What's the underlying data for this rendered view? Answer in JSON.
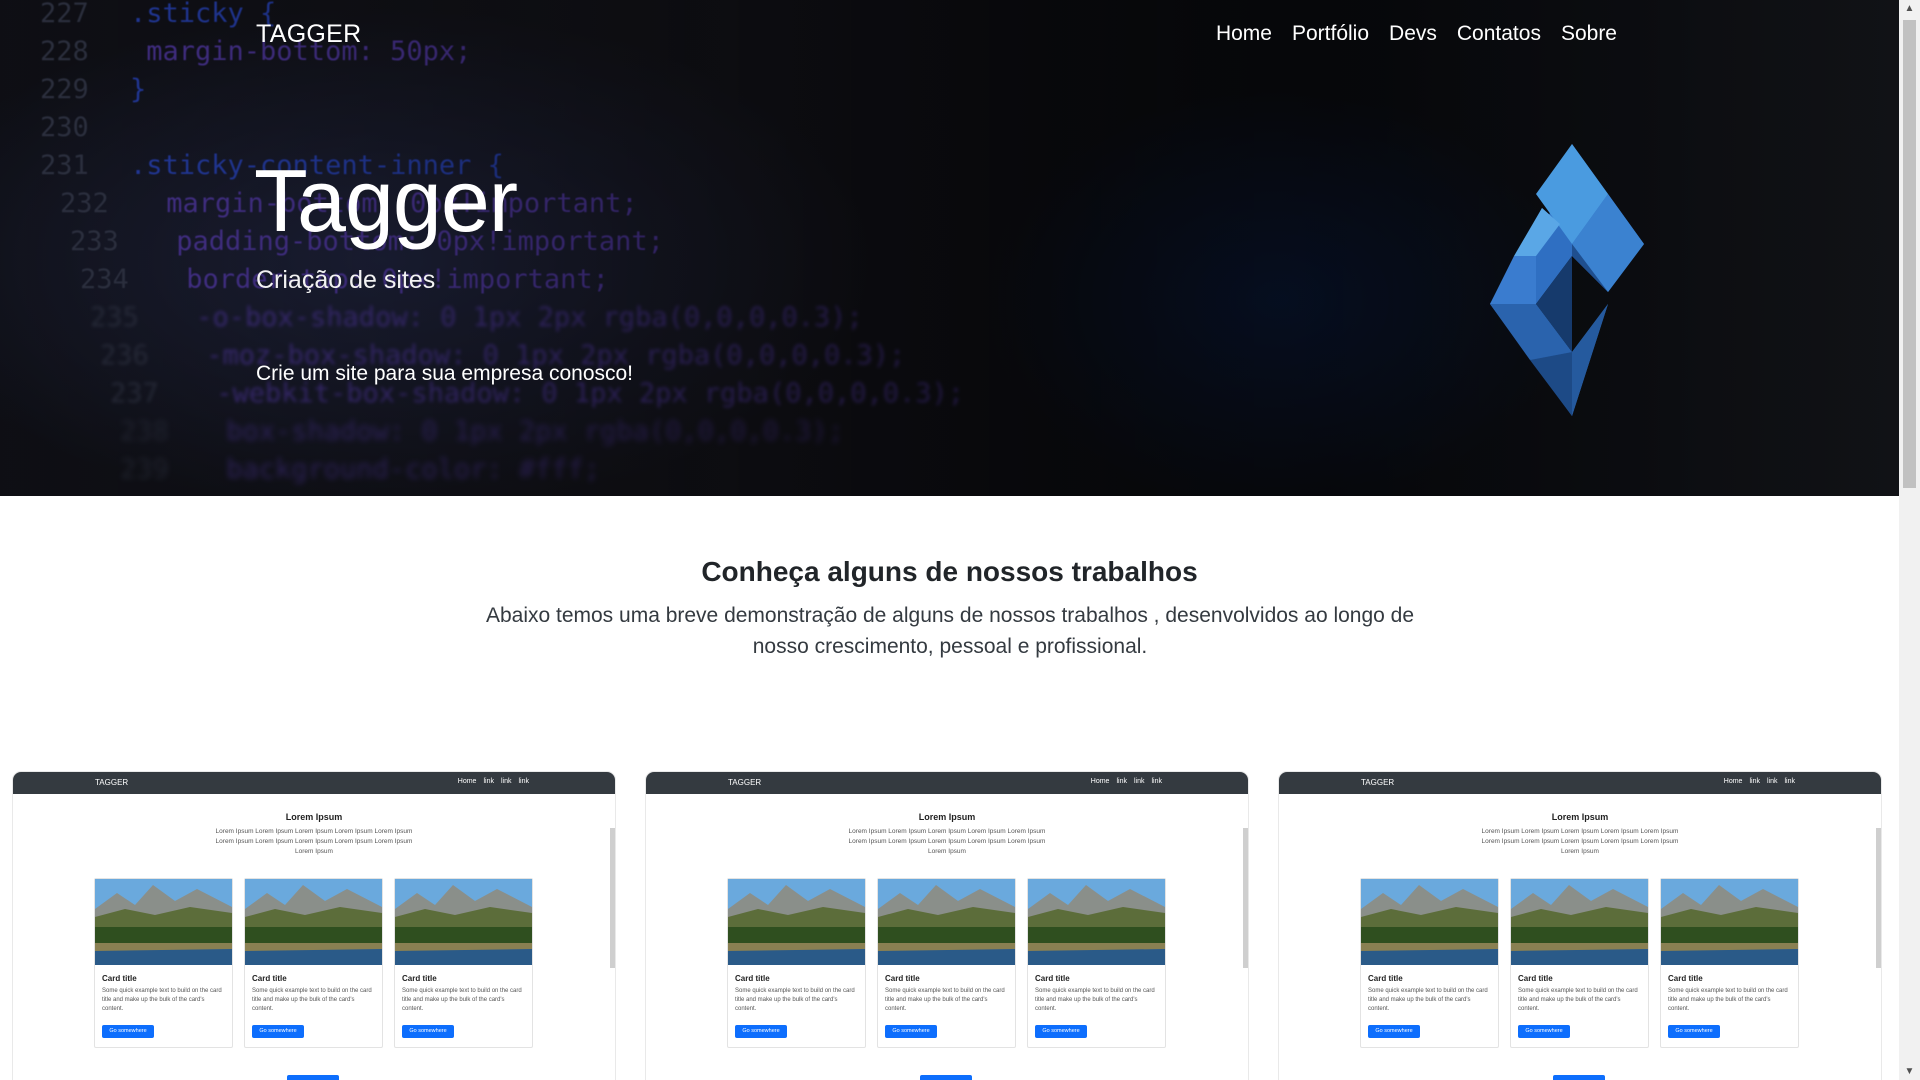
{
  "navbar": {
    "brand": "TAGGER",
    "links": [
      "Home",
      "Portfólio",
      "Devs",
      "Contatos",
      "Sobre"
    ]
  },
  "hero": {
    "title": "Tagger",
    "subtitle": "Criação de sites",
    "cta_text": "Crie um site para sua empresa conosco!",
    "background_code": [
      {
        "ln": "227",
        "code": ".sticky {"
      },
      {
        "ln": "228",
        "code": "   margin-bottom: 50px;"
      },
      {
        "ln": "229",
        "code": "}"
      },
      {
        "ln": "230",
        "code": ""
      },
      {
        "ln": "231",
        "code": ".sticky-content-inner {"
      },
      {
        "ln": "232",
        "code": "   margin-bottom: 0px!important;"
      },
      {
        "ln": "233",
        "code": "   padding-bottom: 0px!important;"
      },
      {
        "ln": "234",
        "code": "   border-top: 0px!important;"
      },
      {
        "ln": "235",
        "code": "   -o-box-shadow: 0 1px 2px rgba(0,0,0,0.3);"
      },
      {
        "ln": "236",
        "code": "   -moz-box-shadow: 0 1px 2px rgba(0,0,0,0.3);"
      },
      {
        "ln": "237",
        "code": "   -webkit-box-shadow: 0 1px 2px rgba(0,0,0,0.3);"
      },
      {
        "ln": "238",
        "code": "   box-shadow: 0 1px 2px rgba(0,0,0,0.3);"
      },
      {
        "ln": "239",
        "code": "   background-color: #fff;"
      }
    ]
  },
  "section": {
    "title": "Conheça alguns de nossos trabalhos",
    "description": "Abaixo temos uma breve demonstração de alguns de nossos trabalhos , desenvolvidos ao longo de nosso crescimento, pessoal e profissional."
  },
  "preview_template": {
    "brand": "TAGGER",
    "links": [
      "Home",
      "link",
      "link",
      "link"
    ],
    "title": "Lorem Ipsum",
    "text": "Lorem Ipsum Lorem Ipsum Lorem Ipsum Lorem Ipsum Lorem Ipsum Lorem Ipsum Lorem Ipsum Lorem Ipsum Lorem Ipsum Lorem Ipsum Lorem Ipsum",
    "cards": [
      {
        "title": "Card title",
        "text": "Some quick example text to build on the card title and make up the bulk of the card's content.",
        "button": "Go somewhere"
      },
      {
        "title": "Card title",
        "text": "Some quick example text to build on the card title and make up the bulk of the card's content.",
        "button": "Go somewhere"
      },
      {
        "title": "Card title",
        "text": "Some quick example text to build on the card title and make up the bulk of the card's content.",
        "button": "Go somewhere"
      }
    ]
  },
  "previews_count": 3,
  "colors": {
    "accent": "#0d6efd",
    "preview_nav": "#343a40",
    "logo_light": "#4a9be0",
    "logo_dark": "#1f4f8f"
  },
  "icons": {
    "scroll_up": "▲",
    "scroll_down": "▼"
  }
}
